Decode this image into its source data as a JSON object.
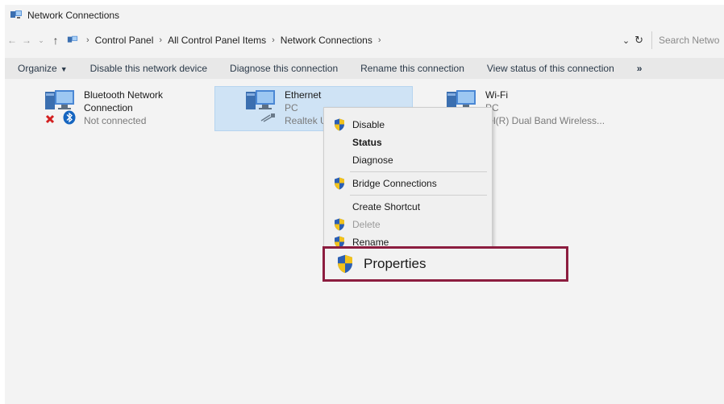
{
  "window": {
    "title": "Network Connections"
  },
  "address": {
    "crumbs": [
      "Control Panel",
      "All Control Panel Items",
      "Network Connections"
    ],
    "search_placeholder": "Search Network Connections"
  },
  "toolbar": {
    "organize": "Organize",
    "disable": "Disable this network device",
    "diagnose": "Diagnose this connection",
    "rename": "Rename this connection",
    "view_status": "View status of this connection",
    "more": "»"
  },
  "connections": [
    {
      "name1": "Bluetooth Network",
      "name2": "Connection",
      "status": "Not connected"
    },
    {
      "name1": "Ethernet",
      "status": "PC",
      "device": "Realtek U"
    },
    {
      "name1": "Wi-Fi",
      "status": "PC",
      "device": "tel(R) Dual Band Wireless..."
    }
  ],
  "context_menu": {
    "items": [
      {
        "label": "Disable"
      },
      {
        "label": "Status"
      },
      {
        "label": "Diagnose"
      },
      {
        "label": "Bridge Connections"
      },
      {
        "label": "Create Shortcut"
      },
      {
        "label": "Delete"
      },
      {
        "label": "Rename"
      }
    ],
    "properties": "Properties"
  },
  "colors": {
    "highlight_border": "#8c1d3f",
    "selection": "#cfe3f5",
    "shield_blue": "#2b5fb3",
    "shield_yellow": "#f2c21b",
    "error_red": "#d32020",
    "bluetooth_blue": "#1565c0"
  }
}
